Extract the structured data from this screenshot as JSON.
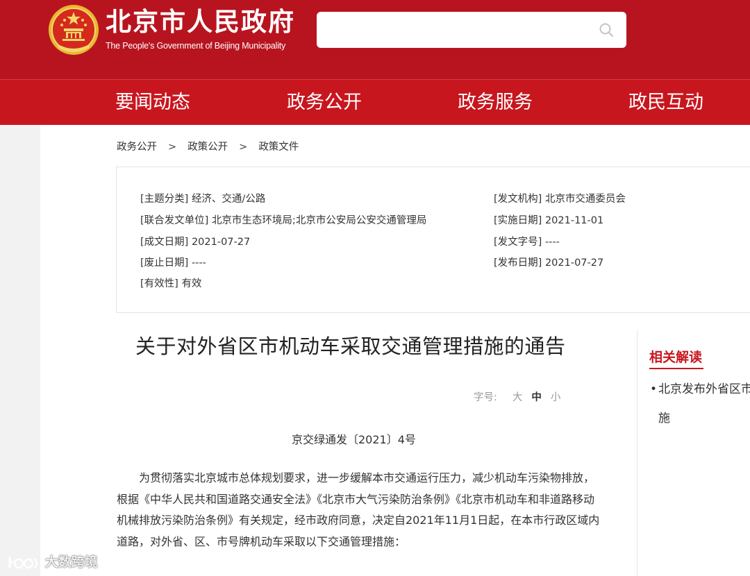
{
  "header": {
    "site_name": "北京市人民政府",
    "site_subtitle": "The People's Government of Beijing Municipality",
    "search_value": "",
    "brand_color": "#b8141f"
  },
  "nav": {
    "items": [
      {
        "label": "要闻动态"
      },
      {
        "label": "政务公开"
      },
      {
        "label": "政务服务"
      },
      {
        "label": "政民互动"
      }
    ]
  },
  "breadcrumb": {
    "items": [
      "政务公开",
      "政策公开",
      "政策文件"
    ],
    "separator": ">"
  },
  "meta": {
    "topic": {
      "key": "[主题分类]",
      "value": "经济、交通/公路"
    },
    "issuer": {
      "key": "[发文机构]",
      "value": "北京市交通委员会"
    },
    "joint_issuer": {
      "key": "[联合发文单位]",
      "value": "北京市生态环境局;北京市公安局公安交通管理局"
    },
    "effective_date": {
      "key": "[实施日期]",
      "value": "2021-11-01"
    },
    "written_date": {
      "key": "[成文日期]",
      "value": "2021-07-27"
    },
    "doc_number": {
      "key": "[发文字号]",
      "value": "----"
    },
    "repeal_date": {
      "key": "[废止日期]",
      "value": "----"
    },
    "publish_date": {
      "key": "[发布日期]",
      "value": "2021-07-27"
    },
    "validity": {
      "key": "[有效性]",
      "value": "有效"
    }
  },
  "document": {
    "title": "关于对外省区市机动车采取交通管理措施的通告",
    "font_size_label": "字号:",
    "font_size_options": [
      "大",
      "中",
      "小"
    ],
    "font_size_selected": "中",
    "number": "京交绿通发〔2021〕4号",
    "paragraph": "为贯彻落实北京城市总体规划要求，进一步缓解本市交通运行压力，减少机动车污染物排放，根据《中华人民共和国道路交通安全法》《北京市大气污染防治条例》《北京市机动车和非道路移动机械排放污染防治条例》有关规定，经市政府同意，决定自2021年11月1日起，在本市行政区域内道路，对外省、区、市号牌机动车采取以下交通管理措施："
  },
  "sidebar": {
    "title": "相关解读",
    "item_line1": "北京发布外省区市",
    "item_line2": "施"
  },
  "watermark": {
    "text": "大数跨境"
  }
}
